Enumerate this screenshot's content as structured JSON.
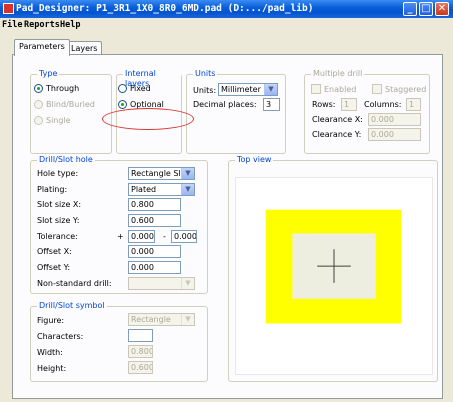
{
  "window": {
    "title": "Pad_Designer: P1_3R1_1X0_8R0_6MD.pad (D:.../pad_lib)",
    "controls": [
      "_",
      "□",
      "✕"
    ]
  },
  "menu": [
    "File",
    "Reports",
    "Help"
  ],
  "tabs": [
    "Parameters",
    "Layers"
  ],
  "type_group": {
    "title": "Type",
    "options": [
      "Through",
      "Blind/Buried",
      "Single"
    ]
  },
  "internal_layers_group": {
    "title": "Internal layers",
    "options": [
      "Fixed",
      "Optional"
    ]
  },
  "units_group": {
    "title": "Units",
    "units_label": "Units:",
    "units_value": "Millimeter",
    "decimal_label": "Decimal places:",
    "decimal_value": "3"
  },
  "multiple_drill_group": {
    "title": "Multiple drill",
    "enabled_label": "Enabled",
    "staggered_label": "Staggered",
    "rows_label": "Rows:",
    "rows_value": "1",
    "columns_label": "Columns:",
    "columns_value": "1",
    "clearance_x_label": "Clearance X:",
    "clearance_x_value": "0.000",
    "clearance_y_label": "Clearance Y:",
    "clearance_y_value": "0.000"
  },
  "drill_slot_hole": {
    "title": "Drill/Slot hole",
    "hole_type_label": "Hole type:",
    "hole_type_value": "Rectangle Slot",
    "plating_label": "Plating:",
    "plating_value": "Plated",
    "slot_size_x_label": "Slot size X:",
    "slot_size_x_value": "0.800",
    "slot_size_y_label": "Slot size Y:",
    "slot_size_y_value": "0.600",
    "tolerance_label": "Tolerance:",
    "tolerance_plus_sign": "+",
    "tolerance_plus_value": "0.000",
    "tolerance_minus_sign": "-",
    "tolerance_minus_value": "0.000",
    "offset_x_label": "Offset X:",
    "offset_x_value": "0.000",
    "offset_y_label": "Offset Y:",
    "offset_y_value": "0.000",
    "non_standard_label": "Non-standard drill:",
    "non_standard_value": ""
  },
  "drill_slot_symbol": {
    "title": "Drill/Slot symbol",
    "figure_label": "Figure:",
    "figure_value": "Rectangle",
    "characters_label": "Characters:",
    "characters_value": "",
    "width_label": "Width:",
    "width_value": "0.800",
    "height_label": "Height:",
    "height_value": "0.600"
  },
  "top_view": {
    "title": "Top view",
    "colors": {
      "background": "#ffffff",
      "pad": "#ffff00",
      "hole": "#eeeee0",
      "crosshair": "#404040"
    }
  },
  "colors": {
    "window_bg": "#ece9d8",
    "group_title": "#0046d5",
    "highlight": "#d9322d",
    "titlebar": "#0a5fd8"
  }
}
